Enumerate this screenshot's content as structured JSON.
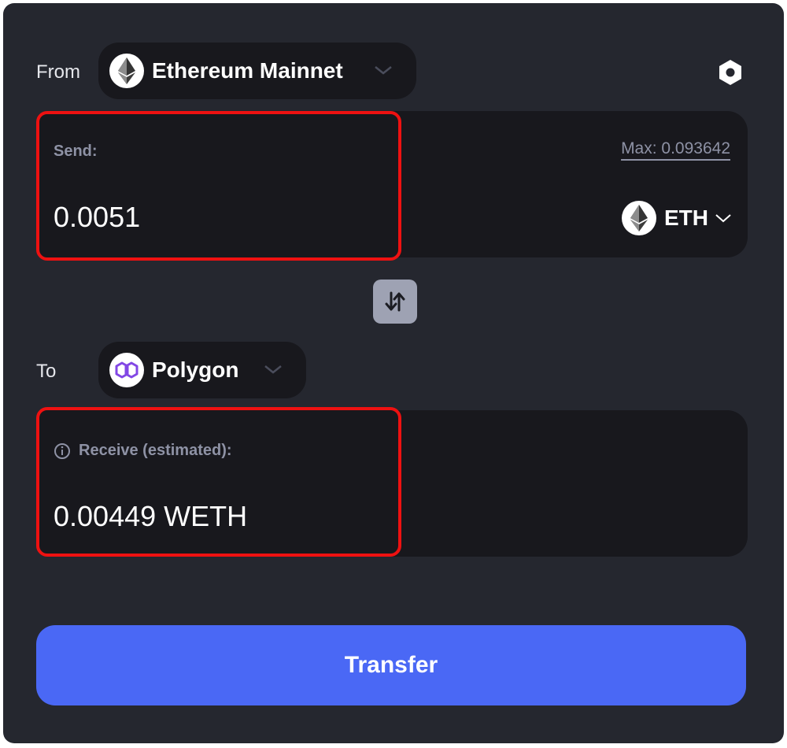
{
  "from": {
    "label": "From",
    "chain_name": "Ethereum Mainnet",
    "chain_icon": "ethereum-icon"
  },
  "send": {
    "label": "Send:",
    "amount": "0.0051",
    "max_text": "Max: 0.093642",
    "token": "ETH",
    "token_icon": "ethereum-icon"
  },
  "swap": {
    "icon": "swap-arrows-icon"
  },
  "to": {
    "label": "To",
    "chain_name": "Polygon",
    "chain_icon": "polygon-icon"
  },
  "receive": {
    "label": "Receive (estimated):",
    "amount": "0.00449 WETH",
    "info_icon": "info-icon"
  },
  "settings_icon": "gear-icon",
  "transfer_label": "Transfer",
  "colors": {
    "card_bg": "#25272f",
    "panel_bg": "#18181d",
    "accent": "#4a68f5",
    "highlight_border": "#ee1111",
    "muted_text": "#8e92a5",
    "polygon_purple": "#8247e5"
  }
}
